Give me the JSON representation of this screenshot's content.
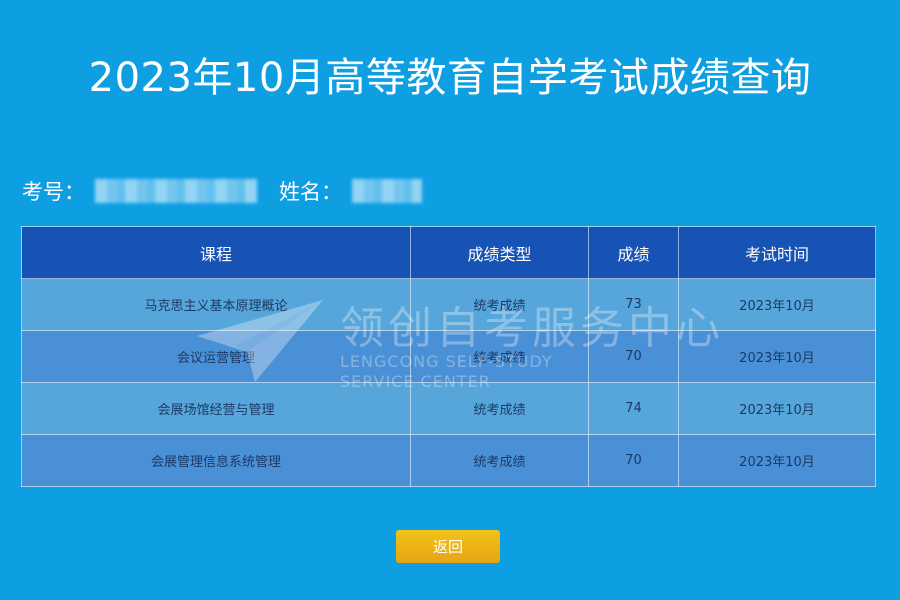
{
  "page": {
    "title": "2023年10月高等教育自学考试成绩查询"
  },
  "candidate": {
    "id_label": "考号：",
    "name_label": "姓名："
  },
  "table": {
    "headers": [
      "课程",
      "成绩类型",
      "成绩",
      "考试时间"
    ],
    "rows": [
      {
        "course": "马克思主义基本原理概论",
        "type": "统考成绩",
        "score": "73",
        "date": "2023年10月"
      },
      {
        "course": "会议运营管理",
        "type": "统考成绩",
        "score": "70",
        "date": "2023年10月"
      },
      {
        "course": "会展场馆经营与管理",
        "type": "统考成绩",
        "score": "74",
        "date": "2023年10月"
      },
      {
        "course": "会展管理信息系统管理",
        "type": "统考成绩",
        "score": "70",
        "date": "2023年10月"
      }
    ]
  },
  "watermark": {
    "main": "领创自考服务中心",
    "sub_line1": "LENGCONG SELF-STUDY",
    "sub_line2": "SERVICE CENTER"
  },
  "actions": {
    "back_label": "返回"
  },
  "colors": {
    "background": "#0e9fe3",
    "header_row": "#1752b5",
    "button": "#e6a514"
  }
}
